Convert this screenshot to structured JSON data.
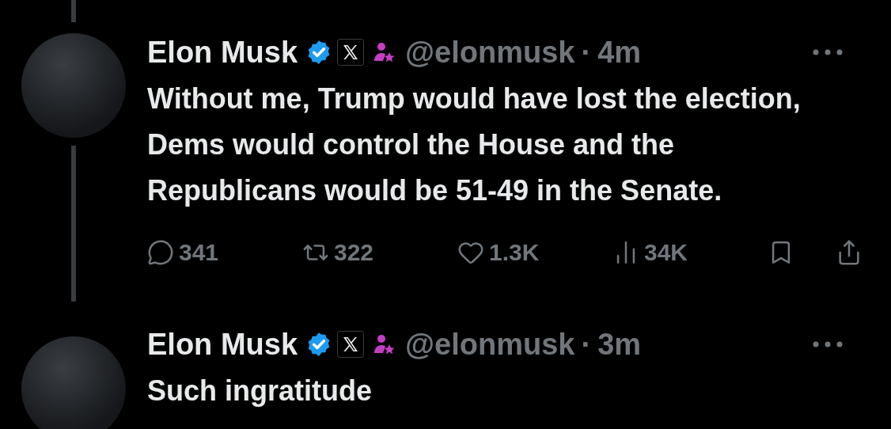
{
  "tweets": [
    {
      "name": "Elon Musk",
      "verified": true,
      "handle": "@elonmusk",
      "separator": "·",
      "time": "4m",
      "text": "Without me, Trump would have lost the election, Dems would control the House and the Republicans would be 51-49 in the Senate.",
      "actions": [
        {
          "kind": "reply",
          "count": "341"
        },
        {
          "kind": "repost",
          "count": "322"
        },
        {
          "kind": "like",
          "count": "1.3K"
        },
        {
          "kind": "views",
          "count": "34K"
        },
        {
          "kind": "bookmark"
        },
        {
          "kind": "share"
        }
      ]
    },
    {
      "name": "Elon Musk",
      "verified": true,
      "handle": "@elonmusk",
      "separator": "·",
      "time": "3m",
      "text": "Such ingratitude"
    }
  ]
}
